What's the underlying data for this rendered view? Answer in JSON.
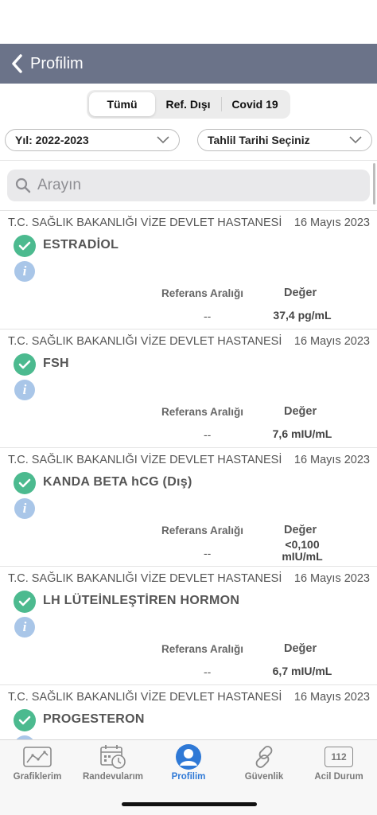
{
  "header": {
    "title": "Profilim"
  },
  "filters": {
    "segments": [
      "Tümü",
      "Ref. Dışı",
      "Covid 19"
    ],
    "active_segment": "Tümü",
    "year_dropdown": "Yıl: 2022-2023",
    "date_dropdown": "Tahlil Tarihi Seçiniz"
  },
  "search": {
    "placeholder": "Arayın"
  },
  "labels": {
    "reference_range": "Referans Aralığı",
    "value": "Değer"
  },
  "results": [
    {
      "hospital": "T.C. SAĞLIK BAKANLIĞI VİZE DEVLET HASTANESİ",
      "date": "16 Mayıs 2023",
      "test": "ESTRADİOL",
      "reference": "--",
      "value": "37,4 pg/mL"
    },
    {
      "hospital": "T.C. SAĞLIK BAKANLIĞI VİZE DEVLET HASTANESİ",
      "date": "16 Mayıs 2023",
      "test": "FSH",
      "reference": "--",
      "value": "7,6 mIU/mL"
    },
    {
      "hospital": "T.C. SAĞLIK BAKANLIĞI VİZE DEVLET HASTANESİ",
      "date": "16 Mayıs 2023",
      "test": "KANDA BETA hCG (Dış)",
      "reference": "--",
      "value_line1": "<0,100",
      "value_line2": "mIU/mL"
    },
    {
      "hospital": "T.C. SAĞLIK BAKANLIĞI VİZE DEVLET HASTANESİ",
      "date": "16 Mayıs 2023",
      "test": "LH LÜTEİNLEŞTİREN HORMON",
      "reference": "--",
      "value": "6,7 mIU/mL"
    },
    {
      "hospital": "T.C. SAĞLIK BAKANLIĞI VİZE DEVLET HASTANESİ",
      "date": "16 Mayıs 2023",
      "test": "PROGESTERON"
    }
  ],
  "tabbar": {
    "items": [
      {
        "label": "Grafiklerim",
        "icon": "chart-icon"
      },
      {
        "label": "Randevularım",
        "icon": "calendar-clock-icon"
      },
      {
        "label": "Profilim",
        "icon": "profile-icon"
      },
      {
        "label": "Güvenlik",
        "icon": "link-icon"
      },
      {
        "label": "Acil Durum",
        "icon": "emergency-112-icon",
        "badge": "112"
      }
    ],
    "active": "Profilim",
    "active_color": "#2f79d6"
  },
  "colors": {
    "nav": "#6b7389",
    "check": "#4cba8f",
    "info": "#a9c6e8"
  }
}
